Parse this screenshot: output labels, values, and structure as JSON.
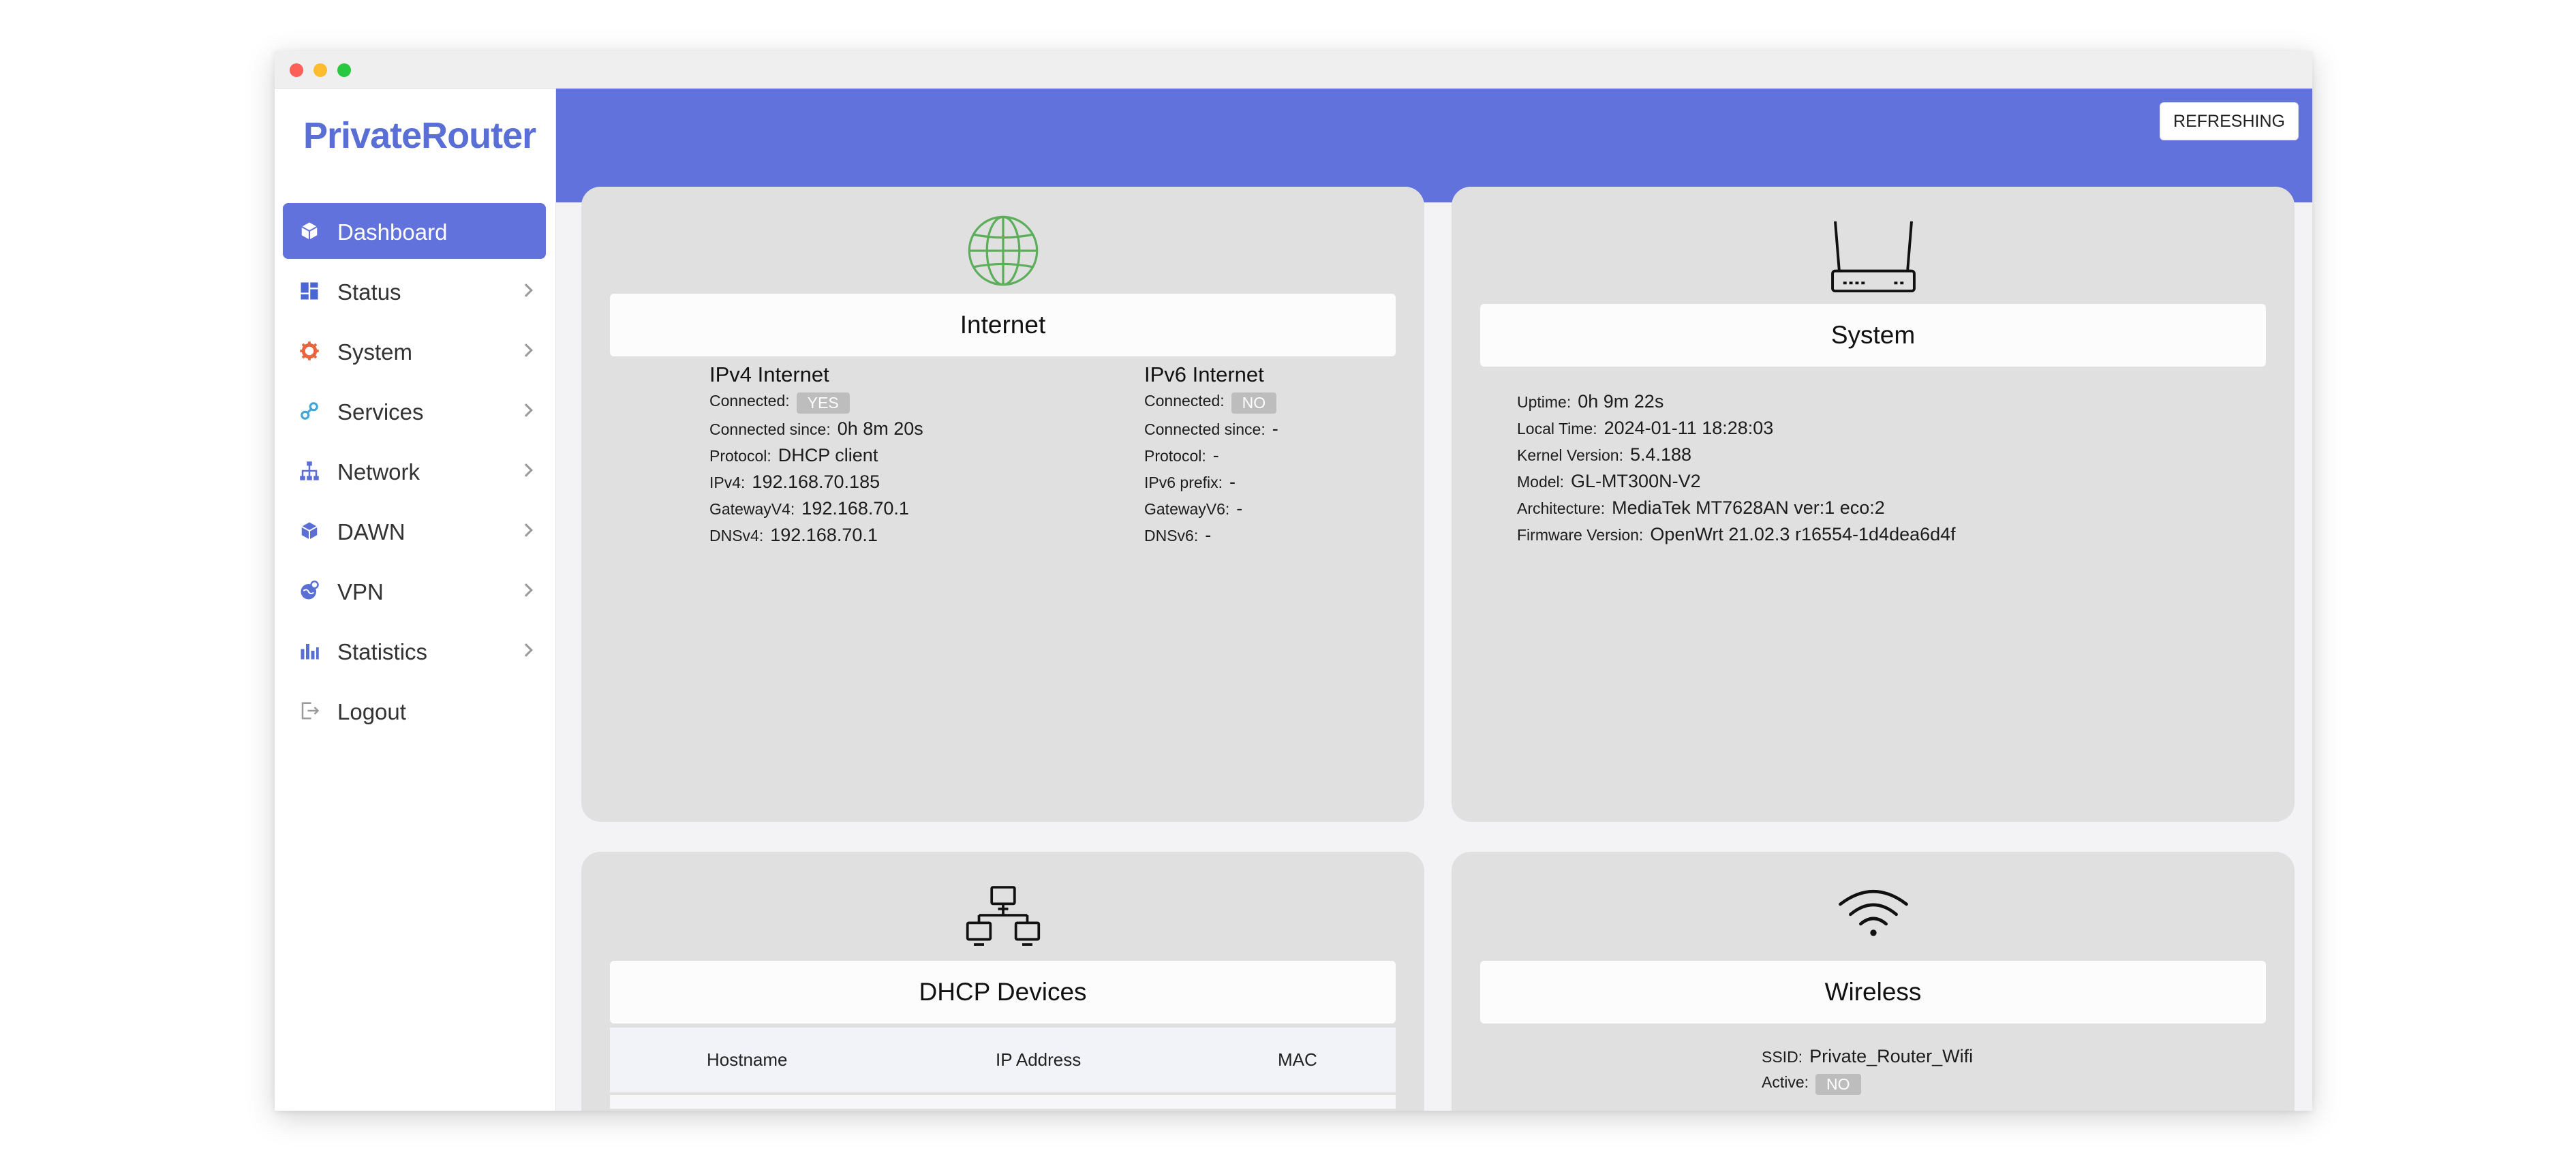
{
  "sidebar": {
    "brand": "PrivateRouter",
    "items": [
      {
        "label": "Dashboard",
        "icon": "cube-icon"
      },
      {
        "label": "Status",
        "icon": "dashboard-grid-icon"
      },
      {
        "label": "System",
        "icon": "gear-icon"
      },
      {
        "label": "Services",
        "icon": "services-icon"
      },
      {
        "label": "Network",
        "icon": "network-tree-icon"
      },
      {
        "label": "DAWN",
        "icon": "cube-icon"
      },
      {
        "label": "VPN",
        "icon": "vpn-globe-icon"
      },
      {
        "label": "Statistics",
        "icon": "bar-chart-icon"
      },
      {
        "label": "Logout",
        "icon": "logout-icon"
      }
    ]
  },
  "header": {
    "refresh_label": "REFRESHING"
  },
  "internet": {
    "title": "Internet",
    "icon": "globe-icon",
    "ipv4": {
      "heading": "IPv4 Internet",
      "connected_label": "Connected:",
      "connected_value": "YES",
      "since_label": "Connected since:",
      "since_value": "0h 8m 20s",
      "protocol_label": "Protocol:",
      "protocol_value": "DHCP client",
      "addr_label": "IPv4:",
      "addr_value": "192.168.70.185",
      "gateway_label": "GatewayV4:",
      "gateway_value": "192.168.70.1",
      "dns_label": "DNSv4:",
      "dns_value": "192.168.70.1"
    },
    "ipv6": {
      "heading": "IPv6 Internet",
      "connected_label": "Connected:",
      "connected_value": "NO",
      "since_label": "Connected since:",
      "since_value": "-",
      "protocol_label": "Protocol:",
      "protocol_value": "-",
      "prefix_label": "IPv6 prefix:",
      "prefix_value": "-",
      "gateway_label": "GatewayV6:",
      "gateway_value": "-",
      "dns_label": "DNSv6:",
      "dns_value": "-"
    }
  },
  "system": {
    "title": "System",
    "icon": "router-icon",
    "uptime_label": "Uptime:",
    "uptime_value": "0h 9m 22s",
    "localtime_label": "Local Time:",
    "localtime_value": "2024-01-11 18:28:03",
    "kernel_label": "Kernel Version:",
    "kernel_value": "5.4.188",
    "model_label": "Model:",
    "model_value": "GL-MT300N-V2",
    "arch_label": "Architecture:",
    "arch_value": "MediaTek MT7628AN ver:1 eco:2",
    "firmware_label": "Firmware Version:",
    "firmware_value": "OpenWrt 21.02.3 r16554-1d4dea6d4f"
  },
  "dhcp": {
    "title": "DHCP Devices",
    "icon": "network-computers-icon",
    "columns": [
      "Hostname",
      "IP Address",
      "MAC"
    ]
  },
  "wireless": {
    "title": "Wireless",
    "icon": "wifi-icon",
    "ssid_label": "SSID:",
    "ssid_value": "Private_Router_Wifi",
    "active_label": "Active:",
    "active_value": "NO"
  },
  "colors": {
    "accent": "#6272dd",
    "brand": "#5a6fd6",
    "card": "#e0e0e0",
    "badge": "#bdbdbd",
    "globe": "#5cae5a"
  }
}
